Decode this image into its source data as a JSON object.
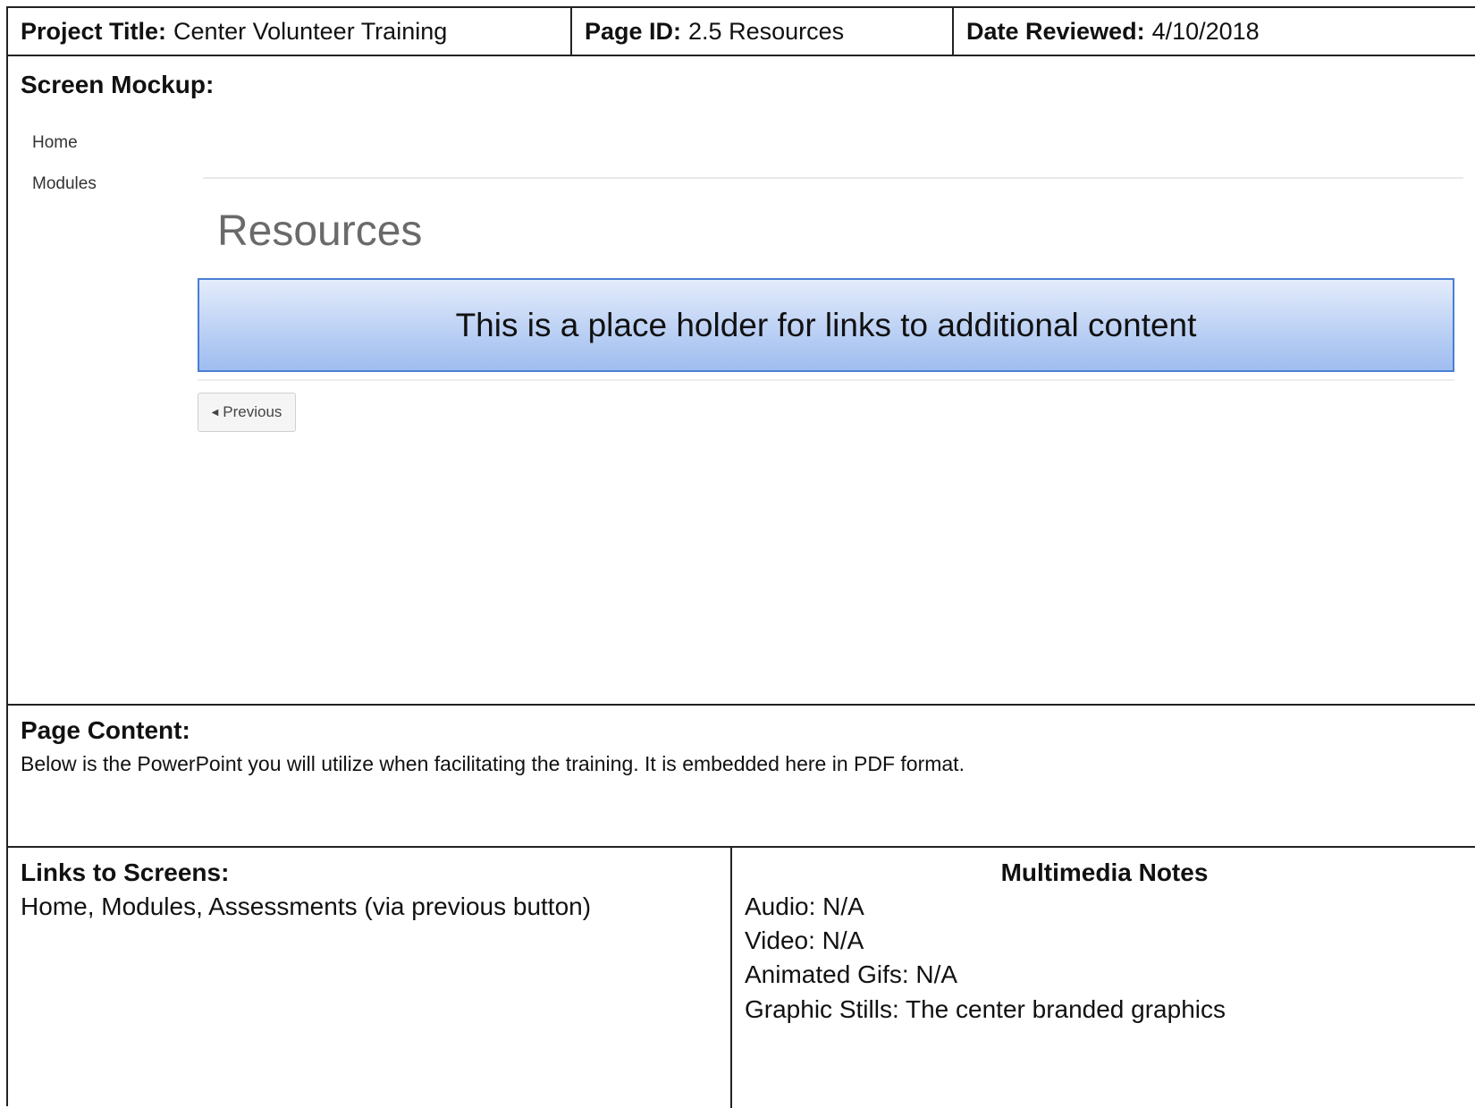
{
  "header": {
    "project_title_label": "Project Title:",
    "project_title_value": "Center Volunteer Training",
    "page_id_label": "Page ID:",
    "page_id_value": "2.5 Resources",
    "date_reviewed_label": "Date Reviewed:",
    "date_reviewed_value": "4/10/2018"
  },
  "mockup": {
    "section_title": "Screen Mockup:",
    "nav": {
      "home": "Home",
      "modules": "Modules"
    },
    "heading": "Resources",
    "banner_text": "This is a place holder for links to additional content",
    "previous_label": "Previous"
  },
  "page_content": {
    "section_title": "Page Content:",
    "text": "Below is the PowerPoint you will utilize when facilitating the training. It is embedded here in PDF format."
  },
  "links": {
    "section_title": "Links to Screens:",
    "text": "Home, Modules, Assessments  (via previous button)"
  },
  "multimedia": {
    "title": "Multimedia Notes",
    "audio": "Audio: N/A",
    "video": "Video: N/A",
    "gifs": "Animated Gifs: N/A",
    "stills": "Graphic Stills: The center branded graphics"
  },
  "colors": {
    "banner_border": "#4a7fd4",
    "banner_fill": "#b9cff4",
    "rule": "#222222"
  }
}
